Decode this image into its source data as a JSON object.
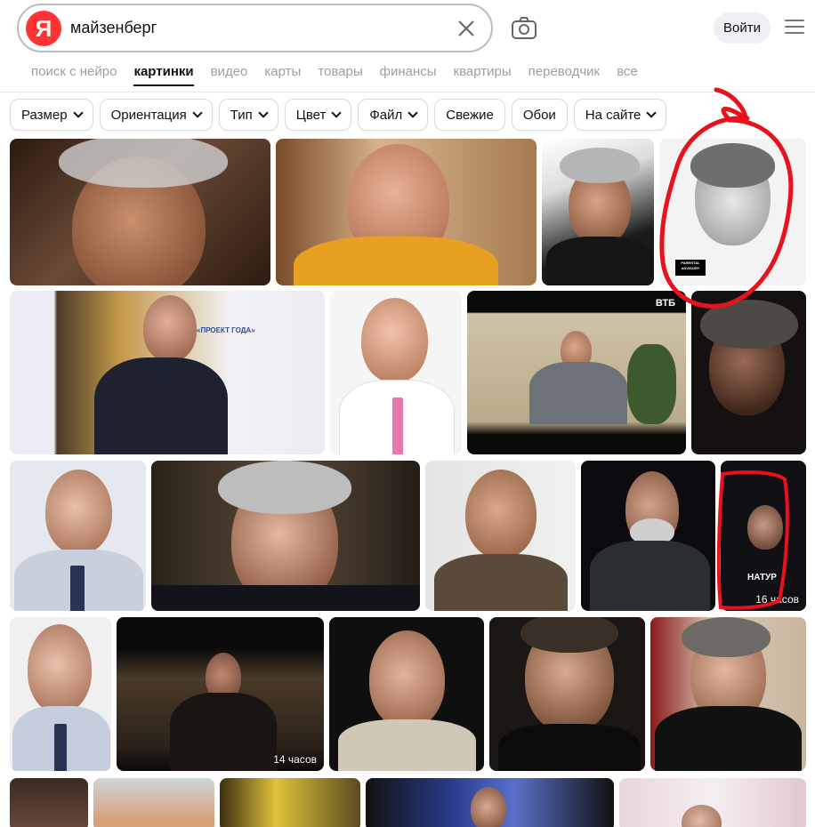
{
  "search": {
    "logo_letter": "Я",
    "query": "майзенберг"
  },
  "header": {
    "login_label": "Войти"
  },
  "tabs": [
    {
      "label": "поиск с нейро",
      "active": false
    },
    {
      "label": "картинки",
      "active": true
    },
    {
      "label": "видео",
      "active": false
    },
    {
      "label": "карты",
      "active": false
    },
    {
      "label": "товары",
      "active": false
    },
    {
      "label": "финансы",
      "active": false
    },
    {
      "label": "квартиры",
      "active": false
    },
    {
      "label": "переводчик",
      "active": false
    },
    {
      "label": "все",
      "active": false
    }
  ],
  "filters": [
    {
      "label": "Размер",
      "dropdown": true
    },
    {
      "label": "Ориентация",
      "dropdown": true
    },
    {
      "label": "Тип",
      "dropdown": true
    },
    {
      "label": "Цвет",
      "dropdown": true
    },
    {
      "label": "Файл",
      "dropdown": true
    },
    {
      "label": "Свежие",
      "dropdown": false
    },
    {
      "label": "Обои",
      "dropdown": false
    },
    {
      "label": "На сайте",
      "dropdown": true
    }
  ],
  "images": {
    "r1c4_badge": "PARENTAL ADVISORY",
    "r2c3_watermark": "ВТБ",
    "r2c2_banner": "«ПРОЕКТ ГОДА»",
    "r3c6_caption": "НАТУР",
    "r3c6_duration": "16 часов",
    "r4c2_duration": "14 часов"
  },
  "colors": {
    "annotation_red": "#e8121f",
    "logo_red": "#ff3333"
  }
}
